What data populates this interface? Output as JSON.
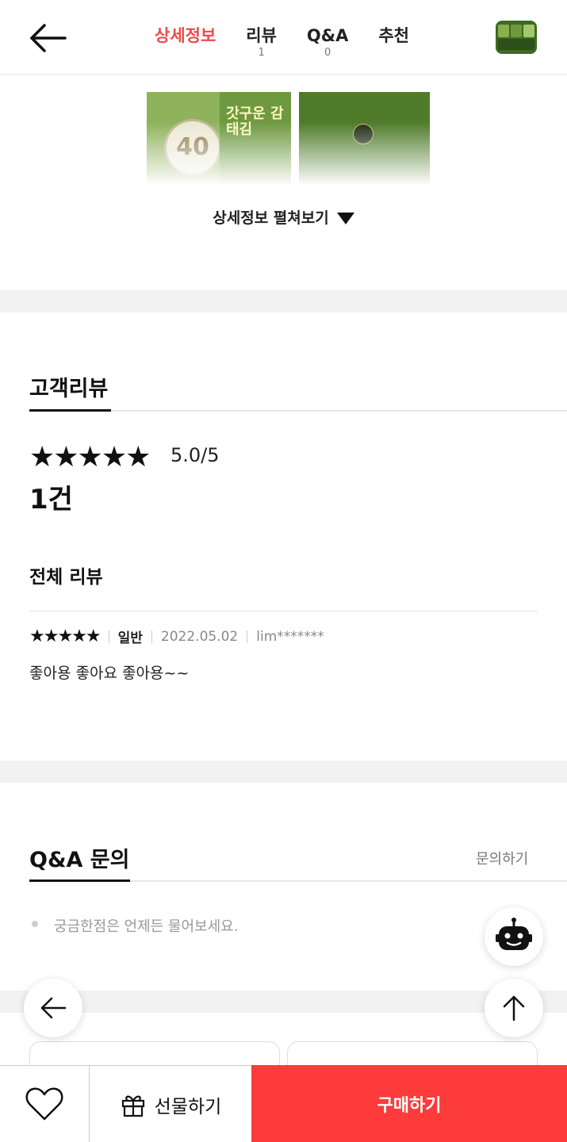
{
  "header": {
    "tabs": [
      {
        "label": "상세정보",
        "count": ""
      },
      {
        "label": "리뷰",
        "count": "1"
      },
      {
        "label": "Q&A",
        "count": "0"
      },
      {
        "label": "추천",
        "count": ""
      }
    ]
  },
  "product": {
    "badge_text": "40",
    "package_title": "갓구운 감태김",
    "expand_label": "상세정보 펼쳐보기"
  },
  "reviews": {
    "title": "고객리뷰",
    "stars": "★★★★★",
    "rating_text": "5.0/5",
    "count_text": "1건",
    "all_reviews_label": "전체 리뷰",
    "items": [
      {
        "stars": "★★★★★",
        "type": "일반",
        "date": "2022.05.02",
        "user": "lim*******",
        "text": "좋아용 좋아요 좋아용~~"
      }
    ]
  },
  "qa": {
    "title": "Q&A 문의",
    "ask_label": "문의하기",
    "empty_text": "궁금한점은 언제든 물어보세요."
  },
  "bottom_bar": {
    "gift_label": "선물하기",
    "buy_label": "구매하기"
  },
  "colors": {
    "accent": "#ee4a4a",
    "buy_button": "#fd3b3b"
  },
  "icons": [
    "back-arrow-icon",
    "heart-icon",
    "gift-icon",
    "chatbot-icon",
    "arrow-left-icon",
    "arrow-up-icon"
  ]
}
